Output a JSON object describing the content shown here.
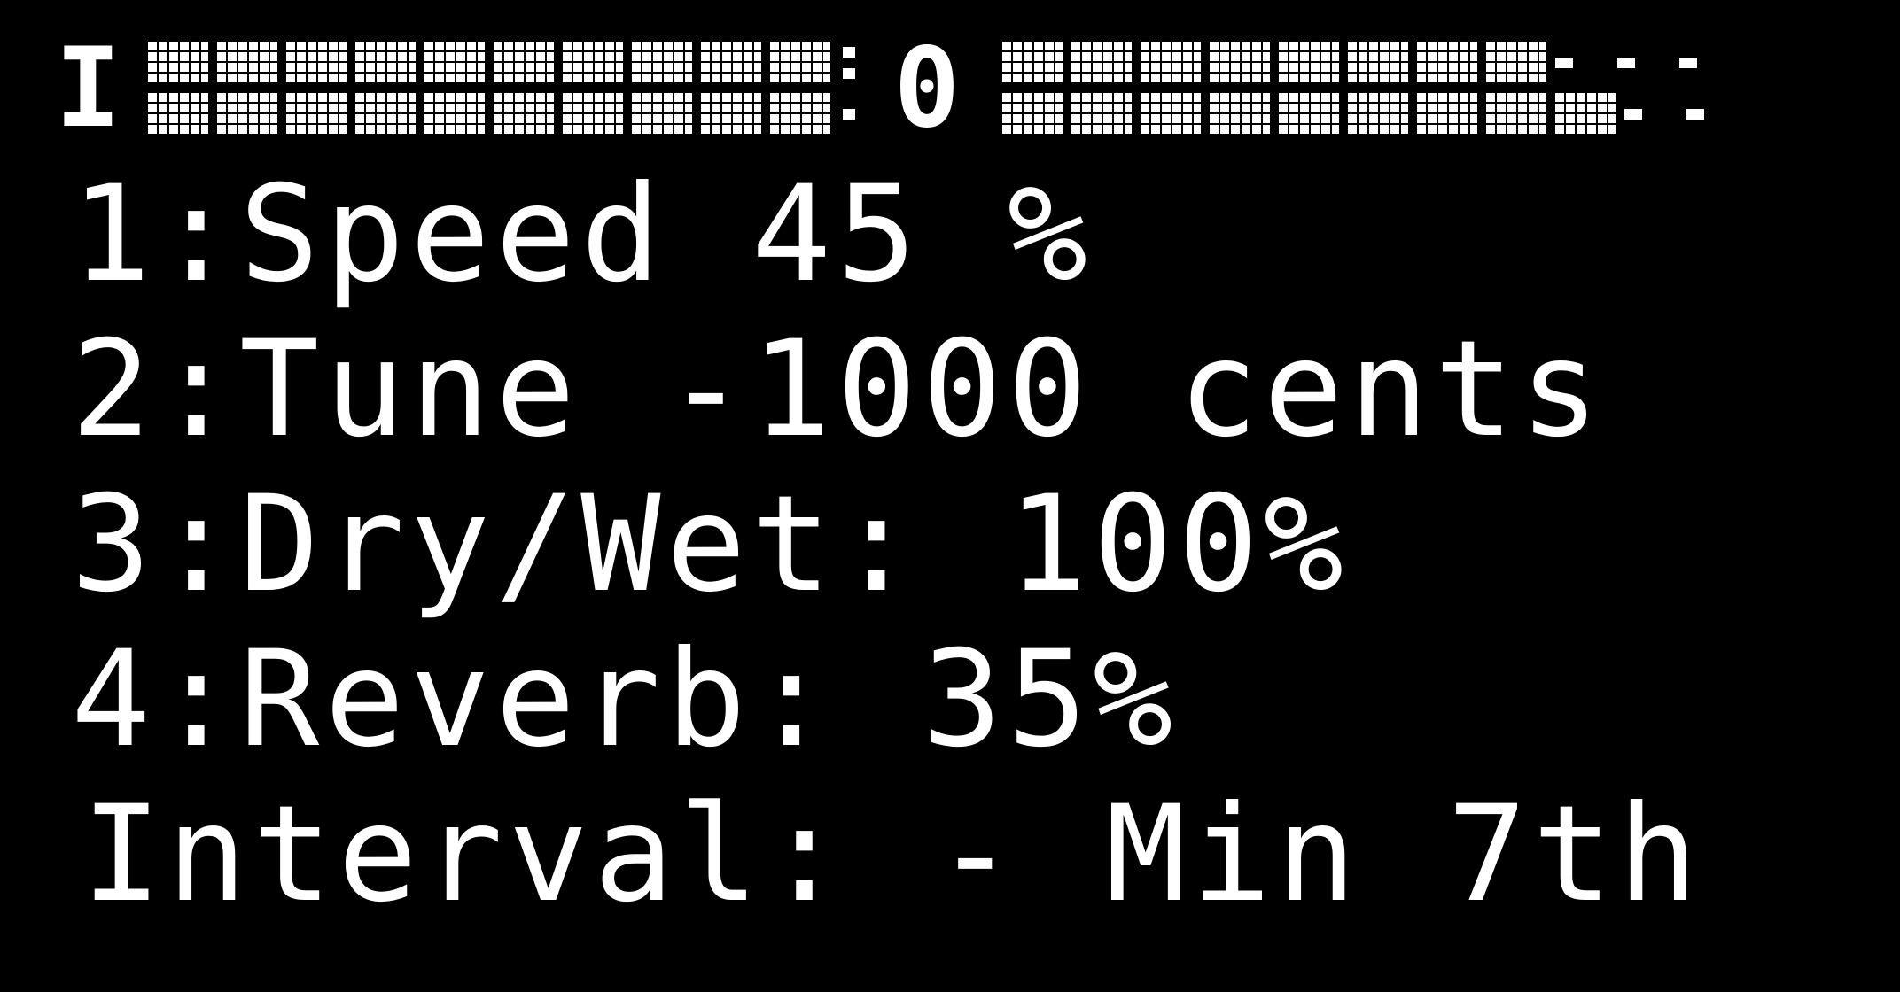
{
  "status_bar": {
    "left_letter": "I",
    "center_value": "0",
    "left_block_count": 10,
    "right_block_count": 8
  },
  "params": [
    {
      "index": "1:",
      "label": "Speed 45 %"
    },
    {
      "index": "2:",
      "label": "Tune -1000 cents"
    },
    {
      "index": "3:",
      "label": "Dry/Wet: 100%"
    },
    {
      "index": "4:",
      "label": "Reverb: 35%"
    }
  ],
  "interval": {
    "label": "Interval: - Min 7th"
  },
  "colors": {
    "background": "#000000",
    "pixel": "#ffffff"
  }
}
